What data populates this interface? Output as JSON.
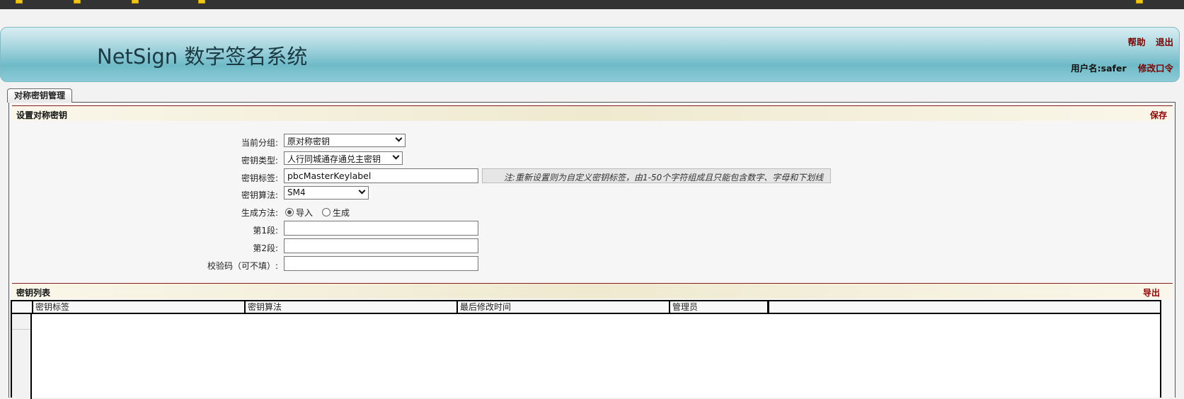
{
  "app": {
    "title": "NetSign 数字签名系统",
    "help_label": "帮助",
    "logout_label": "退出",
    "user_label": "用户名:safer",
    "change_password_label": "修改口令"
  },
  "tab": {
    "label": "对称密钥管理"
  },
  "settings": {
    "section_title": "设置对称密钥",
    "save_label": "保存",
    "fields": {
      "group_label": "当前分组:",
      "group_value": "原对称密钥",
      "type_label": "密钥类型:",
      "type_value": "人行同城通存通兑主密钥",
      "tag_label": "密钥标签:",
      "tag_value": "pbcMasterKeylabel",
      "tag_note": "注:重新设置则为自定义密钥标签，由1-50个字符组成且只能包含数字、字母和下划线",
      "algo_label": "密钥算法:",
      "algo_value": "SM4",
      "method_label": "生成方法:",
      "method_import": "导入",
      "method_generate": "生成",
      "segment1_label": "第1段:",
      "segment1_value": "",
      "segment2_label": "第2段:",
      "segment2_value": "",
      "checksum_label": "校验码（可不填）:",
      "checksum_value": ""
    }
  },
  "keylist": {
    "section_title": "密钥列表",
    "export_label": "导出",
    "columns": [
      "密钥标签",
      "密钥算法",
      "最后修改时间",
      "管理员",
      ""
    ],
    "rows": []
  },
  "colors": {
    "dark_red": "#7a0000",
    "banner_teal": "#6fbac8",
    "topbar": "#333333"
  }
}
